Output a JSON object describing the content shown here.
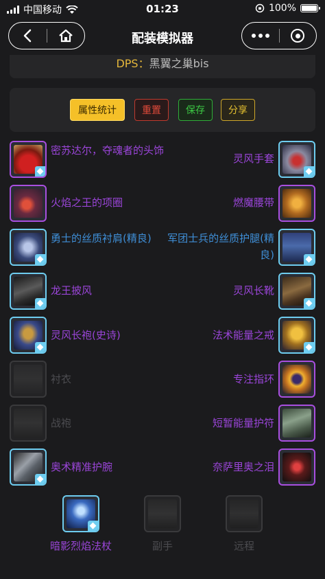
{
  "status_bar": {
    "carrier": "中国移动",
    "time": "01:23",
    "battery": "100%"
  },
  "nav": {
    "title": "配装模拟器"
  },
  "dps": {
    "label": "DPS：",
    "value": "黑翼之巢bis"
  },
  "actions": {
    "stats": "属性统计",
    "reset": "重置",
    "save": "保存",
    "share": "分享"
  },
  "left_slots": [
    {
      "name": "密苏达尔，夺魂者的头饰",
      "quality": "epic",
      "icon": "helmet-icon",
      "equipped": true
    },
    {
      "name": "火焰之王的项圈",
      "quality": "epic",
      "icon": "necklace-icon",
      "equipped": true
    },
    {
      "name": "勇士的丝质衬肩(精良)",
      "quality": "rare",
      "icon": "shoulder-icon",
      "equipped": true
    },
    {
      "name": "龙王披风",
      "quality": "epic",
      "icon": "cloak-icon",
      "equipped": true
    },
    {
      "name": "灵风长袍(史诗)",
      "quality": "epic",
      "icon": "robe-icon",
      "equipped": true
    },
    {
      "name": "衬衣",
      "quality": "empty",
      "icon": "shirt-icon",
      "equipped": false
    },
    {
      "name": "战袍",
      "quality": "empty",
      "icon": "tabard-icon",
      "equipped": false
    },
    {
      "name": "奥术精准护腕",
      "quality": "epic",
      "icon": "bracer-icon",
      "equipped": true
    }
  ],
  "right_slots": [
    {
      "name": "灵风手套",
      "quality": "epic",
      "icon": "gloves-icon",
      "equipped": true
    },
    {
      "name": "燃魔腰带",
      "quality": "epic",
      "icon": "belt-icon",
      "equipped": true
    },
    {
      "name": "军团士兵的丝质护腿(精良)",
      "quality": "rare",
      "icon": "legs-icon",
      "equipped": true
    },
    {
      "name": "灵风长靴",
      "quality": "epic",
      "icon": "boots-icon",
      "equipped": true
    },
    {
      "name": "法术能量之戒",
      "quality": "epic",
      "icon": "ring-icon",
      "equipped": true
    },
    {
      "name": "专注指环",
      "quality": "epic",
      "icon": "ring-icon",
      "equipped": true
    },
    {
      "name": "短暂能量护符",
      "quality": "epic",
      "icon": "trinket-icon",
      "equipped": true
    },
    {
      "name": "奈萨里奥之泪",
      "quality": "epic",
      "icon": "trinket-icon",
      "equipped": true
    }
  ],
  "bottom_slots": [
    {
      "name": "暗影烈焰法杖",
      "quality": "epic",
      "icon": "staff-icon",
      "equipped": true
    },
    {
      "name": "副手",
      "quality": "empty",
      "icon": "shield-icon",
      "equipped": false
    },
    {
      "name": "远程",
      "quality": "empty",
      "icon": "bow-icon",
      "equipped": false
    }
  ],
  "colors": {
    "epic": "#9a45d8",
    "rare": "#3f8fd8",
    "accent": "#e5b73b",
    "frame": "#6ecdf0"
  }
}
